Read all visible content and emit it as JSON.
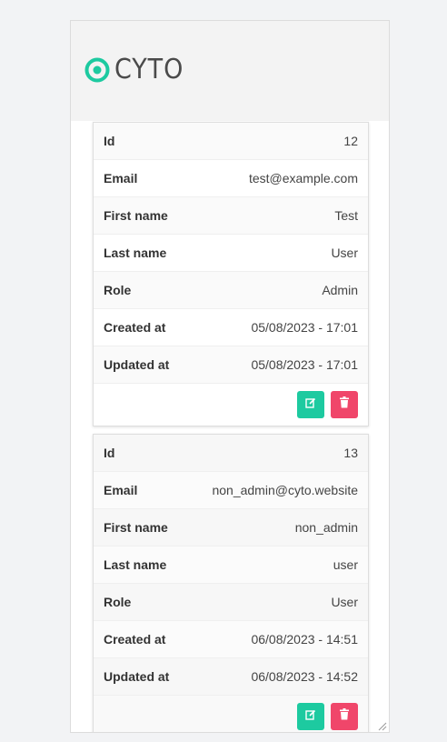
{
  "brand": {
    "name": "CYTO",
    "accent": "#1dcaa0"
  },
  "users": [
    {
      "rows": [
        {
          "label": "Id",
          "value": "12"
        },
        {
          "label": "Email",
          "value": "test@example.com"
        },
        {
          "label": "First name",
          "value": "Test"
        },
        {
          "label": "Last name",
          "value": "User"
        },
        {
          "label": "Role",
          "value": "Admin"
        },
        {
          "label": "Created at",
          "value": "05/08/2023 - 17:01"
        },
        {
          "label": "Updated at",
          "value": "05/08/2023 - 17:01"
        }
      ]
    },
    {
      "rows": [
        {
          "label": "Id",
          "value": "13"
        },
        {
          "label": "Email",
          "value": "non_admin@cyto.website"
        },
        {
          "label": "First name",
          "value": "non_admin"
        },
        {
          "label": "Last name",
          "value": "user"
        },
        {
          "label": "Role",
          "value": "User"
        },
        {
          "label": "Created at",
          "value": "06/08/2023 - 14:51"
        },
        {
          "label": "Updated at",
          "value": "06/08/2023 - 14:52"
        }
      ]
    }
  ],
  "actions": {
    "edit_icon": "edit-icon",
    "delete_icon": "trash-icon",
    "edit_color": "#1dcaa0",
    "delete_color": "#f0466a"
  }
}
